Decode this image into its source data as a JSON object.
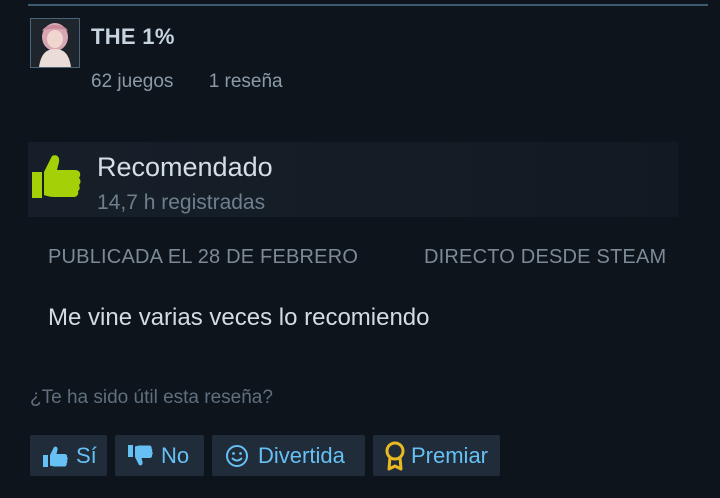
{
  "reviewer": {
    "name": "THE 1%",
    "games": "62 juegos",
    "reviews": "1 reseña"
  },
  "review": {
    "verdict": "Recomendado",
    "hours": "14,7 h registradas",
    "posted": "PUBLICADA EL 28 DE FEBRERO",
    "source": "DIRECTO DESDE STEAM",
    "text": "Me vine varias veces lo recomiendo"
  },
  "helpful": {
    "question": "¿Te ha sido útil esta reseña?",
    "yes_label": "Sí",
    "no_label": "No",
    "funny_label": "Divertida",
    "award_label": "Premiar"
  },
  "icons": {
    "thumb_up": "thumbs-up-icon",
    "thumb_down": "thumbs-down-icon",
    "funny": "smiley-icon",
    "award": "award-ribbon-icon"
  },
  "colors": {
    "background": "#0e141b",
    "accent": "#66c0f4",
    "recommended_thumb": "#a4d007",
    "award_gold": "#e8b920"
  }
}
